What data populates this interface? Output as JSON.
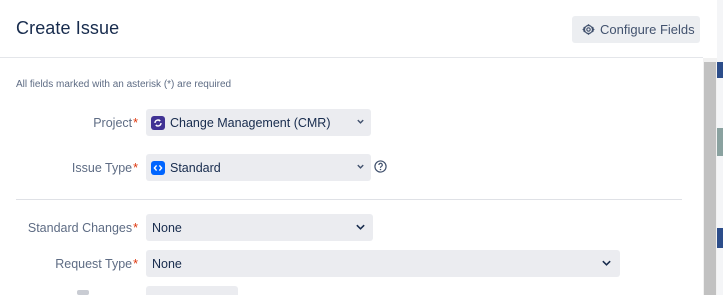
{
  "dialog": {
    "title": "Create Issue",
    "configure_fields_label": "Configure Fields",
    "required_note": "All fields marked with an asterisk (*) are required"
  },
  "fields": {
    "project": {
      "label": "Project",
      "value": "Change Management (CMR)",
      "icon": "project-avatar-icon"
    },
    "issue_type": {
      "label": "Issue Type",
      "value": "Standard",
      "icon": "standard-issue-type-icon"
    },
    "standard_changes": {
      "label": "Standard Changes",
      "value": "None"
    },
    "request_type": {
      "label": "Request Type",
      "value": "None"
    }
  },
  "required_marker": "*",
  "colors": {
    "accent": "#0065ff",
    "required": "#de350b",
    "field_bg": "#ebecf0",
    "button_bg": "#eceef1"
  }
}
